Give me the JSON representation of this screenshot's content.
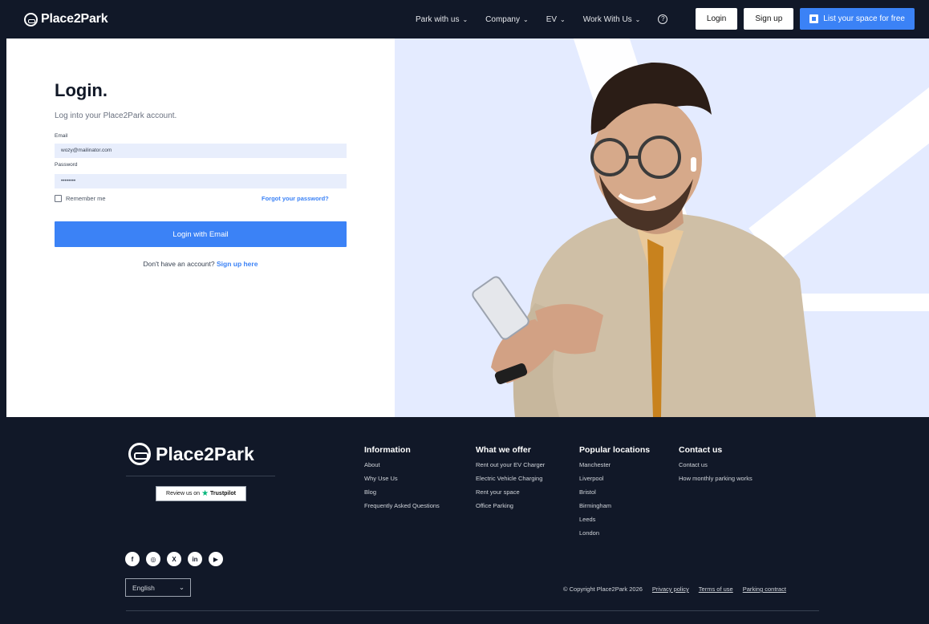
{
  "nav": {
    "logo": "Place2Park",
    "links": [
      "Park with us",
      "Company",
      "EV",
      "Work With Us"
    ],
    "login": "Login",
    "signup": "Sign up",
    "list_space": "List your space for free"
  },
  "login": {
    "title": "Login.",
    "subtitle": "Log into your Place2Park account.",
    "email_label": "Email",
    "email_value": "wozy@mailinator.com",
    "password_label": "Password",
    "password_value": "••••••••",
    "remember": "Remember me",
    "forgot": "Forgot your password?",
    "submit": "Login with Email",
    "no_account": "Don't have an account?",
    "signup_link": "Sign up here"
  },
  "footer": {
    "logo": "Place2Park",
    "trustpilot_prefix": "Review us on",
    "trustpilot_name": "Trustpilot",
    "columns": [
      {
        "title": "Information",
        "items": [
          "About",
          "Why Use Us",
          "Blog",
          "Frequently Asked Questions"
        ]
      },
      {
        "title": "What we offer",
        "items": [
          "Rent out your EV Charger",
          "Electric Vehicle Charging",
          "Rent your space",
          "Office Parking"
        ]
      },
      {
        "title": "Popular locations",
        "items": [
          "Manchester",
          "Liverpool",
          "Bristol",
          "Birmingham",
          "Leeds",
          "London"
        ]
      },
      {
        "title": "Contact us",
        "items": [
          "Contact us",
          "How monthly parking works"
        ]
      }
    ],
    "socials": [
      "f",
      "◎",
      "X",
      "in",
      "▶"
    ],
    "language": "English",
    "copyright": "© Copyright Place2Park 2026",
    "privacy": "Privacy policy",
    "terms": "Terms of use",
    "contract": "Parking contract"
  }
}
